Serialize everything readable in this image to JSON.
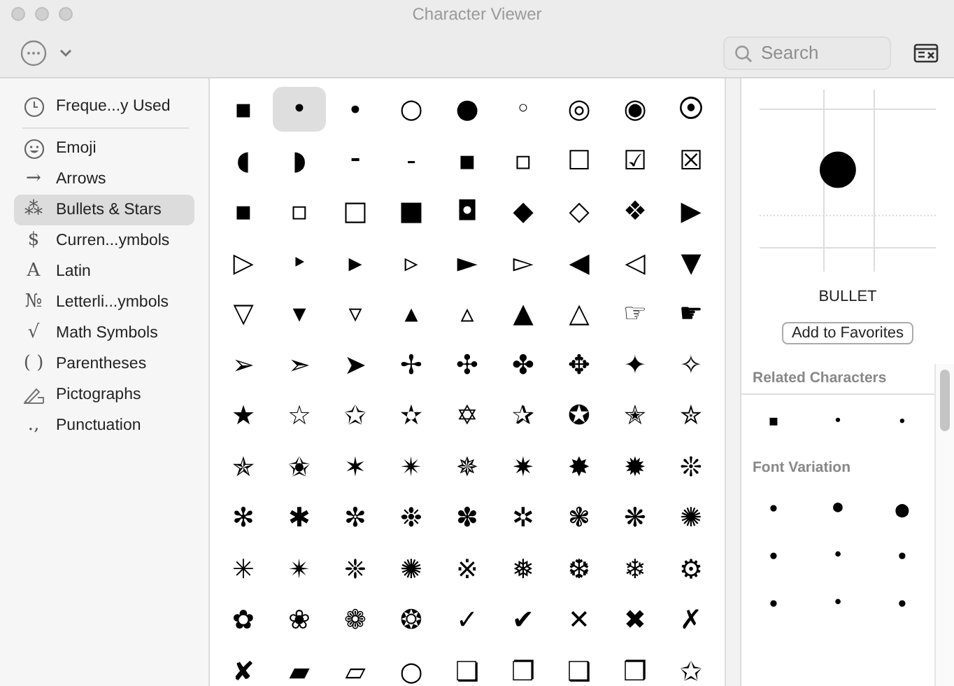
{
  "window": {
    "title": "Character Viewer"
  },
  "search": {
    "placeholder": "Search"
  },
  "sidebar": {
    "items": [
      {
        "kind": "clock",
        "label": "Freque...y Used",
        "selected": false
      },
      {
        "kind": "face",
        "label": "Emoji",
        "selected": false
      },
      {
        "kind": "glyph",
        "glyph": "→",
        "label": "Arrows",
        "selected": false
      },
      {
        "kind": "glyph",
        "glyph": "⁂",
        "label": "Bullets & Stars",
        "selected": true
      },
      {
        "kind": "glyph",
        "glyph": "$",
        "label": "Curren...ymbols",
        "selected": false
      },
      {
        "kind": "glyph",
        "glyph": "A",
        "label": "Latin",
        "selected": false
      },
      {
        "kind": "glyph",
        "glyph": "№",
        "label": "Letterli...ymbols",
        "selected": false
      },
      {
        "kind": "glyph",
        "glyph": "√",
        "label": "Math Symbols",
        "selected": false
      },
      {
        "kind": "glyph",
        "glyph": "( )",
        "label": "Parentheses",
        "selected": false
      },
      {
        "kind": "pen",
        "label": "Pictographs",
        "selected": false
      },
      {
        "kind": "glyph",
        "glyph": "․,",
        "label": "Punctuation",
        "selected": false
      }
    ]
  },
  "grid": {
    "cells": [
      {
        "char": "▪",
        "selected": false
      },
      {
        "char": "•",
        "selected": true
      },
      {
        "char": "∙",
        "selected": false
      },
      {
        "char": "○",
        "selected": false
      },
      {
        "char": "●",
        "selected": false
      },
      {
        "char": "◦",
        "selected": false
      },
      {
        "char": "◎",
        "selected": false
      },
      {
        "char": "◉",
        "selected": false
      },
      {
        "char": "⦿",
        "selected": false
      },
      {
        "char": "◖",
        "selected": false
      },
      {
        "char": "◗",
        "selected": false
      },
      {
        "char": "⁃",
        "selected": false
      },
      {
        "char": "‐",
        "selected": false
      },
      {
        "char": "▪",
        "selected": false
      },
      {
        "char": "▫",
        "selected": false
      },
      {
        "char": "☐",
        "selected": false
      },
      {
        "char": "☑",
        "selected": false
      },
      {
        "char": "☒",
        "selected": false
      },
      {
        "char": "▪",
        "selected": false
      },
      {
        "char": "▫",
        "selected": false
      },
      {
        "char": "□",
        "selected": false
      },
      {
        "char": "■",
        "selected": false
      },
      {
        "char": "◘",
        "selected": false
      },
      {
        "char": "◆",
        "selected": false
      },
      {
        "char": "◇",
        "selected": false
      },
      {
        "char": "❖",
        "selected": false
      },
      {
        "char": "▶",
        "selected": false
      },
      {
        "char": "▷",
        "selected": false
      },
      {
        "char": "‣",
        "selected": false
      },
      {
        "char": "▸",
        "selected": false
      },
      {
        "char": "▹",
        "selected": false
      },
      {
        "char": "►",
        "selected": false
      },
      {
        "char": "▻",
        "selected": false
      },
      {
        "char": "◀",
        "selected": false
      },
      {
        "char": "◁",
        "selected": false
      },
      {
        "char": "▼",
        "selected": false
      },
      {
        "char": "▽",
        "selected": false
      },
      {
        "char": "▾",
        "selected": false
      },
      {
        "char": "▿",
        "selected": false
      },
      {
        "char": "▴",
        "selected": false
      },
      {
        "char": "▵",
        "selected": false
      },
      {
        "char": "▲",
        "selected": false
      },
      {
        "char": "△",
        "selected": false
      },
      {
        "char": "☞",
        "selected": false
      },
      {
        "char": "☛",
        "selected": false
      },
      {
        "char": "➢",
        "selected": false
      },
      {
        "char": "➣",
        "selected": false
      },
      {
        "char": "➤",
        "selected": false
      },
      {
        "char": "✢",
        "selected": false
      },
      {
        "char": "✣",
        "selected": false
      },
      {
        "char": "✤",
        "selected": false
      },
      {
        "char": "✥",
        "selected": false
      },
      {
        "char": "✦",
        "selected": false
      },
      {
        "char": "✧",
        "selected": false
      },
      {
        "char": "★",
        "selected": false
      },
      {
        "char": "☆",
        "selected": false
      },
      {
        "char": "✩",
        "selected": false
      },
      {
        "char": "✫",
        "selected": false
      },
      {
        "char": "✡",
        "selected": false
      },
      {
        "char": "✰",
        "selected": false
      },
      {
        "char": "✪",
        "selected": false
      },
      {
        "char": "✭",
        "selected": false
      },
      {
        "char": "✮",
        "selected": false
      },
      {
        "char": "✯",
        "selected": false
      },
      {
        "char": "✬",
        "selected": false
      },
      {
        "char": "✶",
        "selected": false
      },
      {
        "char": "✴",
        "selected": false
      },
      {
        "char": "✵",
        "selected": false
      },
      {
        "char": "✷",
        "selected": false
      },
      {
        "char": "✸",
        "selected": false
      },
      {
        "char": "✹",
        "selected": false
      },
      {
        "char": "❊",
        "selected": false
      },
      {
        "char": "✻",
        "selected": false
      },
      {
        "char": "✱",
        "selected": false
      },
      {
        "char": "✼",
        "selected": false
      },
      {
        "char": "❉",
        "selected": false
      },
      {
        "char": "✽",
        "selected": false
      },
      {
        "char": "✲",
        "selected": false
      },
      {
        "char": "❃",
        "selected": false
      },
      {
        "char": "❋",
        "selected": false
      },
      {
        "char": "✺",
        "selected": false
      },
      {
        "char": "✳",
        "selected": false
      },
      {
        "char": "✴",
        "selected": false
      },
      {
        "char": "❈",
        "selected": false
      },
      {
        "char": "✺",
        "selected": false
      },
      {
        "char": "※",
        "selected": false
      },
      {
        "char": "❅",
        "selected": false
      },
      {
        "char": "❆",
        "selected": false
      },
      {
        "char": "❄",
        "selected": false
      },
      {
        "char": "⚙",
        "selected": false
      },
      {
        "char": "✿",
        "selected": false
      },
      {
        "char": "❀",
        "selected": false
      },
      {
        "char": "❁",
        "selected": false
      },
      {
        "char": "❂",
        "selected": false
      },
      {
        "char": "✓",
        "selected": false
      },
      {
        "char": "✔",
        "selected": false
      },
      {
        "char": "✕",
        "selected": false
      },
      {
        "char": "✖",
        "selected": false
      },
      {
        "char": "✗",
        "selected": false
      },
      {
        "char": "✘",
        "selected": false
      },
      {
        "char": "▰",
        "selected": false
      },
      {
        "char": "▱",
        "selected": false
      },
      {
        "char": "○",
        "selected": false
      },
      {
        "char": "❏",
        "selected": false
      },
      {
        "char": "❐",
        "selected": false
      },
      {
        "char": "❑",
        "selected": false
      },
      {
        "char": "❒",
        "selected": false
      },
      {
        "char": "✩",
        "selected": false
      }
    ]
  },
  "preview": {
    "char": "●",
    "name": "BULLET",
    "button": "Add to Favorites"
  },
  "related": {
    "title": "Related Characters",
    "chars": [
      "▪",
      "•",
      "∙"
    ]
  },
  "font_variation": {
    "title": "Font Variation",
    "chars": [
      "•",
      "●",
      "●",
      "•",
      "•",
      "•",
      "•",
      "•",
      "•"
    ]
  }
}
